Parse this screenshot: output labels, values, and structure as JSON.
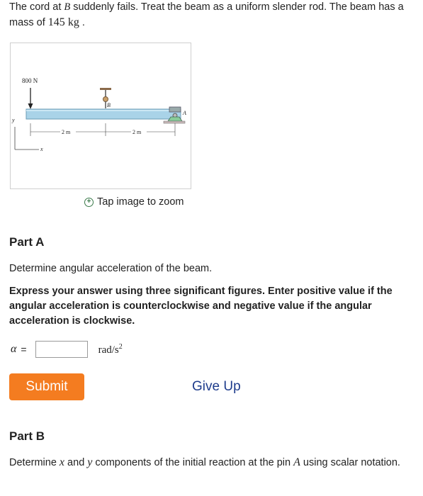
{
  "problem": {
    "text_1": "The cord at ",
    "var_b": "B",
    "text_2": " suddenly fails. Treat the beam as a uniform slender rod. The beam has a mass of ",
    "mass_value": "145",
    "mass_unit": "kg",
    "text_end": "."
  },
  "figure": {
    "force_label": "800 N",
    "cord_label": "B",
    "pin_label": "A",
    "dim_left": "2 m",
    "dim_right": "2 m",
    "axis_y": "y",
    "axis_x": "x"
  },
  "zoom_label": "Tap image to zoom",
  "part_a": {
    "title": "Part A",
    "question": "Determine angular acceleration of the beam.",
    "instructions": "Express your answer using three significant figures. Enter positive value if the angular acceleration is counterclockwise and negative value if the angular acceleration is clockwise.",
    "variable": "α",
    "equals": "=",
    "input_value": "",
    "unit_base": "rad/s",
    "unit_exp": "2",
    "submit_label": "Submit",
    "give_up_label": "Give Up"
  },
  "part_b": {
    "title": "Part B",
    "text_1": "Determine ",
    "var_x": "x",
    "text_2": " and ",
    "var_y": "y",
    "text_3": " components of the initial reaction at the pin ",
    "var_a": "A",
    "text_4": " using scalar notation."
  },
  "colors": {
    "beam": "#a9d3e8",
    "submit_bg": "#f47c20",
    "give_up_link": "#1e3c8c"
  }
}
